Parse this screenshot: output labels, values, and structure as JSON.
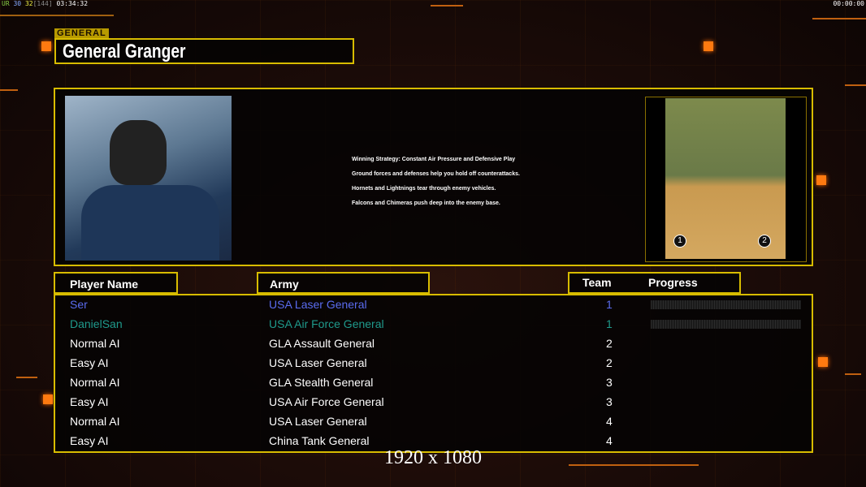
{
  "hud": {
    "left_prefix": "UR",
    "left_a": "30",
    "left_b": "32",
    "left_c": "[144]",
    "left_time": "03:34:32",
    "right_time": "00:00:00"
  },
  "general": {
    "tag": "GENERAL",
    "name": "General Granger"
  },
  "strategy": [
    "Winning Strategy: Constant Air Pressure and Defensive Play",
    "Ground forces and defenses help you hold off counterattacks.",
    "Hornets and Lightnings tear through enemy vehicles.",
    "Falcons and Chimeras push deep into the enemy base."
  ],
  "map": {
    "start_1": "1",
    "start_2": "2"
  },
  "headers": {
    "player": "Player Name",
    "army": "Army",
    "team": "Team",
    "progress": "Progress"
  },
  "players": [
    {
      "name": "Ser",
      "army": "USA Laser General",
      "team": "1",
      "color": "#5a6cf0",
      "progress": 0
    },
    {
      "name": "DanielSan",
      "army": "USA Air Force General",
      "team": "1",
      "color": "#1f9a8c",
      "progress": 0
    },
    {
      "name": "Normal AI",
      "army": "GLA Assault General",
      "team": "2",
      "color": "#ffffff"
    },
    {
      "name": "Easy AI",
      "army": "USA Laser General",
      "team": "2",
      "color": "#ffffff"
    },
    {
      "name": "Normal AI",
      "army": "GLA Stealth General",
      "team": "3",
      "color": "#ffffff"
    },
    {
      "name": "Easy AI",
      "army": "USA Air Force General",
      "team": "3",
      "color": "#ffffff"
    },
    {
      "name": "Normal AI",
      "army": "USA Laser General",
      "team": "4",
      "color": "#ffffff"
    },
    {
      "name": "Easy AI",
      "army": "China Tank General",
      "team": "4",
      "color": "#ffffff"
    }
  ],
  "resolution": "1920 x 1080"
}
